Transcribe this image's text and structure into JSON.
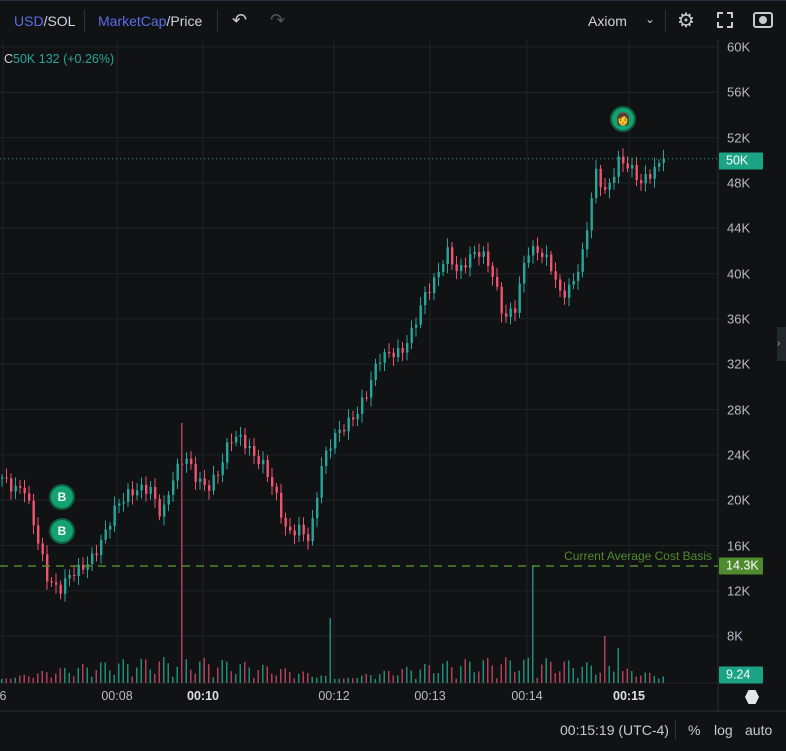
{
  "toolbar": {
    "pair_quote": "USD",
    "pair_base": "SOL",
    "mode_a": "MarketCap",
    "mode_b": "Price",
    "theme": "Axiom"
  },
  "legend": {
    "prefix": "C",
    "value": "50K 132 (+0.26%)"
  },
  "price_axis": [
    "60K",
    "56K",
    "52K",
    "48K",
    "44K",
    "40K",
    "36K",
    "32K",
    "28K",
    "24K",
    "20K",
    "16K",
    "12K",
    "8K"
  ],
  "badges": {
    "last_price": "50K",
    "cost_basis": "14.3K",
    "volume": "9.24"
  },
  "cost_basis_label": "Current Average Cost Basis",
  "time_axis": [
    {
      "label": "6",
      "bold": false
    },
    {
      "label": "00:08",
      "bold": false
    },
    {
      "label": "00:10",
      "bold": true
    },
    {
      "label": "00:12",
      "bold": false
    },
    {
      "label": "00:13",
      "bold": false
    },
    {
      "label": "00:14",
      "bold": false
    },
    {
      "label": "00:15",
      "bold": true
    }
  ],
  "markers": [
    {
      "label": "B"
    },
    {
      "label": "B"
    }
  ],
  "footer": {
    "time": "00:15:19 (UTC-4)",
    "percent": "%",
    "log": "log",
    "auto": "auto"
  },
  "colors": {
    "up": "#26a69a",
    "down": "#ef5370",
    "accent": "#1aa385",
    "cost": "#4f8a2e",
    "blue": "#5a6ee8"
  },
  "chart_data": {
    "type": "candlestick",
    "unit": "K USD market cap",
    "key_closes": [
      22,
      21,
      21,
      17,
      13,
      12,
      13.5,
      14,
      15,
      17,
      19.5,
      20.5,
      21,
      21,
      18.5,
      22,
      24,
      22,
      21,
      22.5,
      25.5,
      25.5,
      24,
      23,
      20.5,
      17,
      17.5,
      16.5,
      23,
      25.5,
      26.5,
      27.5,
      29.5,
      32.5,
      33,
      33,
      35,
      38,
      39.5,
      42,
      40,
      41.5,
      42,
      40,
      36,
      37,
      42,
      42,
      41,
      38,
      39,
      42,
      49,
      47,
      50,
      49.5,
      48,
      49,
      50
    ],
    "last": 50.132,
    "cost_basis": 14.3,
    "ylim": [
      6,
      61
    ]
  }
}
